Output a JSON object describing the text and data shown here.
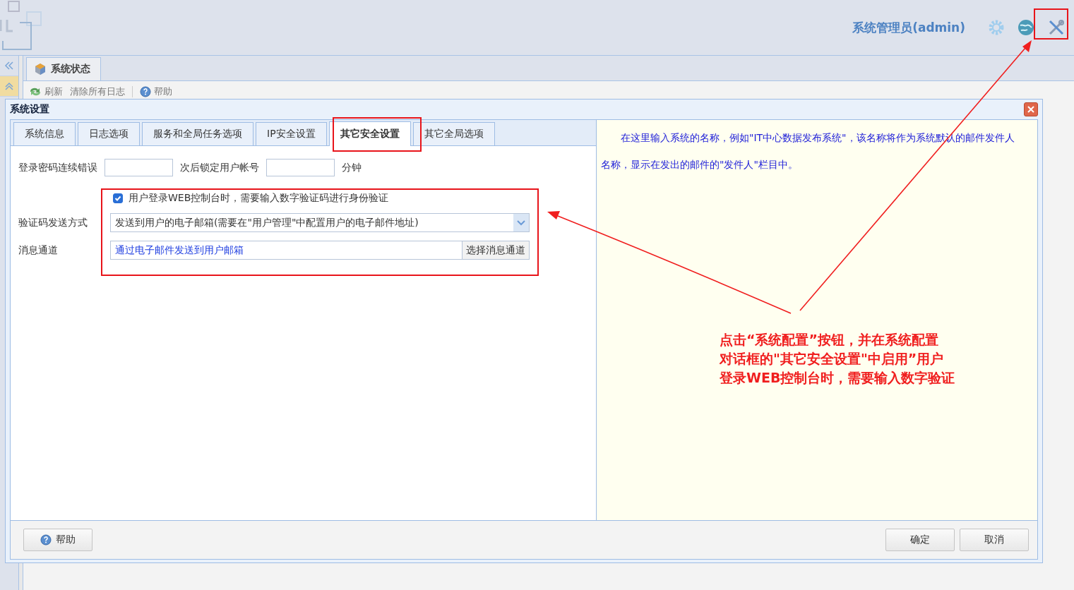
{
  "header": {
    "user": "系统管理员(admin)"
  },
  "main_tab": {
    "label": "系统状态"
  },
  "toolbar": [
    {
      "label": "刷新",
      "kind": "refresh"
    },
    {
      "label": "清除所有日志",
      "kind": "plain"
    },
    {
      "label": "帮助",
      "kind": "help"
    }
  ],
  "dialog": {
    "title": "系统设置",
    "tabs": [
      {
        "label": "系统信息",
        "selected": false
      },
      {
        "label": "日志选项",
        "selected": false
      },
      {
        "label": "服务和全局任务选项",
        "selected": false
      },
      {
        "label": "IP安全设置",
        "selected": false
      },
      {
        "label": "其它安全设置",
        "selected": true
      },
      {
        "label": "其它全局选项",
        "selected": false
      }
    ],
    "lockout": {
      "label": "登录密码连续错误",
      "middle": "次后锁定用户帐号",
      "unit": "分钟"
    },
    "captcha": {
      "label": "用户登录WEB控制台时，需要输入数字验证码进行身份验证",
      "checked": true
    },
    "send_method": {
      "label": "验证码发送方式",
      "value": "发送到用户的电子邮箱(需要在\"用户管理\"中配置用户的电子邮件地址)"
    },
    "channel": {
      "label": "消息通道",
      "value": "通过电子邮件发送到用户邮箱",
      "button": "选择消息通道"
    },
    "help_text": "在这里输入系统的名称，例如\"IT中心数据发布系统\"，该名称将作为系统默认的邮件发件人名称，显示在发出的邮件的\"发件人\"栏目中。",
    "buttons": [
      {
        "label": "帮助",
        "kind": "help"
      },
      {
        "label": "确定",
        "kind": "plain"
      },
      {
        "label": "取消",
        "kind": "plain"
      }
    ]
  },
  "annotation": {
    "lines": [
      "点击“系统配置”按钮，并在系统配置",
      "对话框的\"其它安全设置\"中启用”用户",
      "登录WEB控制台时，需要输入数字验证"
    ]
  }
}
